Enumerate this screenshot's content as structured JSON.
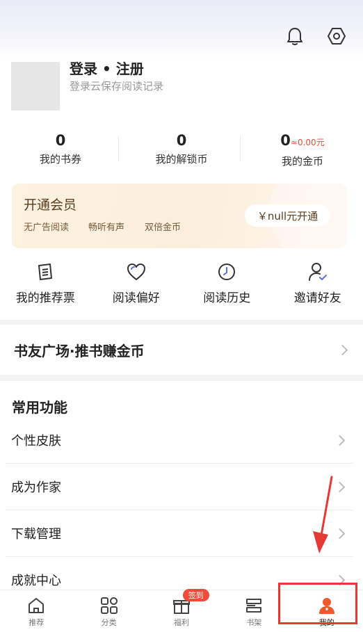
{
  "header": {
    "icons": [
      "bell-icon",
      "settings-icon"
    ]
  },
  "profile": {
    "title": "登录 • 注册",
    "subtitle": "登录云保存阅读记录"
  },
  "stats": [
    {
      "value": "0",
      "extra": "",
      "label": "我的书券"
    },
    {
      "value": "0",
      "extra": "",
      "label": "我的解锁币"
    },
    {
      "value": "0",
      "extra": "≈0.00元",
      "label": "我的金币"
    }
  ],
  "vip": {
    "title": "开通会员",
    "features": [
      "无广告阅读",
      "畅听有声",
      "双倍金币"
    ],
    "button": "￥null元开通"
  },
  "quick_actions": [
    {
      "label": "我的推荐票",
      "icon": "ticket-icon"
    },
    {
      "label": "阅读偏好",
      "icon": "heart-icon"
    },
    {
      "label": "阅读历史",
      "icon": "clock-icon"
    },
    {
      "label": "邀请好友",
      "icon": "invite-user-icon"
    }
  ],
  "banner": {
    "title": "书友广场·推书赚金币"
  },
  "functions": {
    "title": "常用功能",
    "items": [
      "个性皮肤",
      "成为作家",
      "下载管理",
      "成就中心"
    ]
  },
  "tabbar": {
    "items": [
      {
        "label": "推荐",
        "icon": "home-icon"
      },
      {
        "label": "分类",
        "icon": "grid-icon"
      },
      {
        "label": "福利",
        "icon": "gift-icon",
        "badge": "签到"
      },
      {
        "label": "书架",
        "icon": "bookshelf-icon"
      },
      {
        "label": "我的",
        "icon": "user-icon"
      }
    ],
    "active": "我的"
  },
  "colors": {
    "accent": "#ef5a2a",
    "annotation": "#e53935",
    "vip_text": "#5a3d1e"
  }
}
